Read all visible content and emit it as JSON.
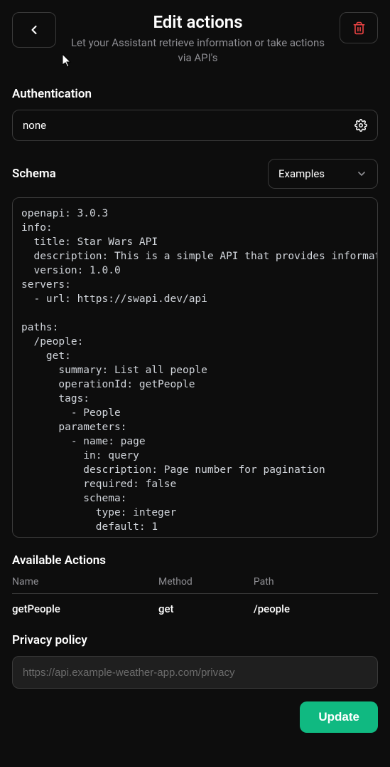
{
  "header": {
    "title": "Edit actions",
    "subtitle": "Let your Assistant retrieve information or take actions via API's"
  },
  "authentication": {
    "label": "Authentication",
    "value": "none"
  },
  "schema": {
    "label": "Schema",
    "examples_label": "Examples",
    "content": "openapi: 3.0.3\ninfo:\n  title: Star Wars API\n  description: This is a simple API that provides information about the Star Wars universe.\n  version: 1.0.0\nservers:\n  - url: https://swapi.dev/api\n\npaths:\n  /people:\n    get:\n      summary: List all people\n      operationId: getPeople\n      tags:\n        - People\n      parameters:\n        - name: page\n          in: query\n          description: Page number for pagination\n          required: false\n          schema:\n            type: integer\n            default: 1"
  },
  "available_actions": {
    "label": "Available Actions",
    "columns": [
      "Name",
      "Method",
      "Path"
    ],
    "rows": [
      {
        "name": "getPeople",
        "method": "get",
        "path": "/people"
      }
    ]
  },
  "privacy": {
    "label": "Privacy policy",
    "placeholder": "https://api.example-weather-app.com/privacy"
  },
  "buttons": {
    "update": "Update"
  }
}
